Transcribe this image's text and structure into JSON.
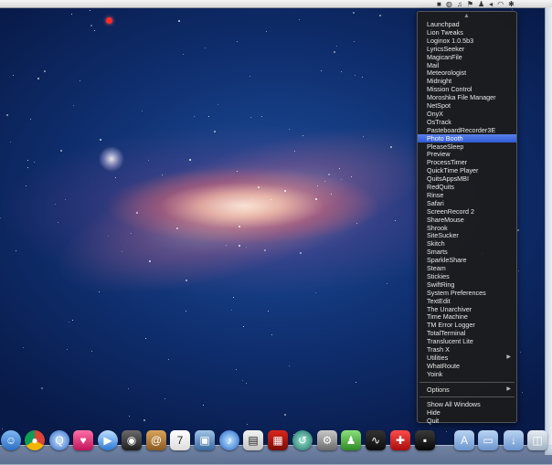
{
  "menu": {
    "items": [
      {
        "label": "Launchpad"
      },
      {
        "label": "Lion Tweaks"
      },
      {
        "label": "Loginox 1.0.5b3"
      },
      {
        "label": "LyricsSeeker"
      },
      {
        "label": "MagicanFile"
      },
      {
        "label": "Mail"
      },
      {
        "label": "Meteorologist"
      },
      {
        "label": "Midnight"
      },
      {
        "label": "Mission Control"
      },
      {
        "label": "Moroshka File Manager"
      },
      {
        "label": "NetSpot"
      },
      {
        "label": "OnyX"
      },
      {
        "label": "OsTrack"
      },
      {
        "label": "PasteboardRecorder3E"
      },
      {
        "label": "Photo Booth",
        "selected": true
      },
      {
        "label": "PleaseSleep"
      },
      {
        "label": "Preview"
      },
      {
        "label": "ProcessTimer"
      },
      {
        "label": "QuickTime Player"
      },
      {
        "label": "QuitsAppsMBI"
      },
      {
        "label": "RedQuits"
      },
      {
        "label": "Rinse"
      },
      {
        "label": "Safari"
      },
      {
        "label": "ScreenRecord 2"
      },
      {
        "label": "ShareMouse"
      },
      {
        "label": "Shrook"
      },
      {
        "label": "SiteSucker"
      },
      {
        "label": "Skitch"
      },
      {
        "label": "Smarts"
      },
      {
        "label": "SparkleShare"
      },
      {
        "label": "Steam"
      },
      {
        "label": "Stickies"
      },
      {
        "label": "SwiftRing"
      },
      {
        "label": "System Preferences"
      },
      {
        "label": "TextEdit"
      },
      {
        "label": "The Unarchiver"
      },
      {
        "label": "Time Machine"
      },
      {
        "label": "TM Error Logger"
      },
      {
        "label": "TotalTerminal"
      },
      {
        "label": "Translucent Lite"
      },
      {
        "label": "Trash X"
      },
      {
        "label": "Utilities",
        "submenu": true
      },
      {
        "label": "WhatRoute"
      },
      {
        "label": "Yoink"
      }
    ],
    "options_label": "Options",
    "show_all_label": "Show All Windows",
    "hide_label": "Hide",
    "quit_label": "Quit"
  },
  "colors": {
    "menu_bg": "#1c1c1c",
    "selection": "#2f59d6"
  },
  "dock": {
    "icons": [
      "finder-icon",
      "chrome-icon",
      "quicktime-icon",
      "heart-app-icon",
      "facetime-icon",
      "camera-icon",
      "address-book-icon",
      "calendar-icon",
      "photo-app-icon",
      "itunes-icon",
      "preview-icon",
      "photo-booth-icon",
      "time-machine-icon",
      "system-preferences-icon",
      "robot-app-icon",
      "activity-monitor-icon",
      "toolbox-icon",
      "black-app-icon",
      "folder-icon",
      "documents-icon",
      "downloads-icon",
      "trash-icon"
    ]
  }
}
